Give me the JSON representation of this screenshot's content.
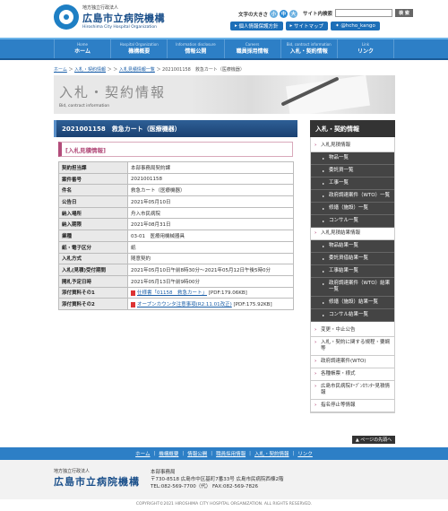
{
  "header": {
    "org_sub": "地方独立行政法人",
    "org_name": "広島市立病院機構",
    "org_en": "Hiroshima City Hospital Organization",
    "fontsize_label": "文字の大きさ",
    "fontsize_small": "小",
    "fontsize_medium": "中",
    "fontsize_large": "大",
    "search_label": "サイト内検索",
    "search_button": "検 索",
    "links": [
      "個人情報保護方針",
      "サイトマップ",
      "@hcho_kango"
    ]
  },
  "gnav": [
    {
      "en": "Home",
      "jp": "ホーム"
    },
    {
      "en": "Hospital Organization",
      "jp": "機構概要"
    },
    {
      "en": "Information disclosure",
      "jp": "情報公開"
    },
    {
      "en": "Careers",
      "jp": "職員採用情報"
    },
    {
      "en": "Bid, contract information",
      "jp": "入札・契約情報"
    },
    {
      "en": "Link",
      "jp": "リンク"
    }
  ],
  "breadcrumb": {
    "home": "ホーム",
    "level1": "入札・契約情報",
    "level2": "入札見積情報一覧",
    "current": "2021001158　救急カート（医療機器）"
  },
  "banner": {
    "title": "入札・契約情報",
    "subtitle": "Bid, contract information"
  },
  "main": {
    "title": "2021001158　救急カート（医療機器）",
    "category": "[入札見積情報]",
    "rows": [
      {
        "label": "契約担当課",
        "value": "本部事務局契約課"
      },
      {
        "label": "案件番号",
        "value": "2021001158"
      },
      {
        "label": "件名",
        "value": "救急カート（医療機器）"
      },
      {
        "label": "公告日",
        "value": "2021年05月10日"
      },
      {
        "label": "納入場所",
        "value": "舟入市民病院"
      },
      {
        "label": "納入期限",
        "value": "2021年08月31日"
      },
      {
        "label": "業種",
        "value": "03-01　医療用機械器具"
      },
      {
        "label": "紙・電子区分",
        "value": "紙"
      },
      {
        "label": "入札方式",
        "value": "随意契約"
      },
      {
        "label": "入札(見積)受付期間",
        "value": "2021年05月10日午前8時30分～2021年05月12日午後5時0分"
      },
      {
        "label": "開札予定日時",
        "value": "2021年05月13日午前9時00分"
      }
    ],
    "attach1_label": "添付資料その1",
    "attach1_link": "仕様書「01158　救急カート」",
    "attach1_size": "[PDF:179.06KB]",
    "attach2_label": "添付資料その2",
    "attach2_link": "オープンカウンタ注意事項(R2.11.01改正)",
    "attach2_size": "[PDF:175.92KB]"
  },
  "sidebar": {
    "head": "入札・契約情報",
    "group1": "入札見積情報",
    "group1_items": [
      "物品一覧",
      "委託資一覧",
      "工事一覧",
      "政府調達案件（WTO）一覧",
      "修繕（施設）一覧",
      "コンサル一覧"
    ],
    "group2": "入札見積結果情報",
    "group2_items": [
      "物品結果一覧",
      "委託資借結果一覧",
      "工事結果一覧",
      "政府調達案件（WTO）結果一覧",
      "修繕（施設）結果一覧",
      "コンサル結果一覧"
    ],
    "other_items": [
      "変更・中止公告",
      "入札・契約に関する規程・要綱等",
      "政府調達案件(WTO)",
      "各種帳票・様式",
      "広島市民病院ｵｰﾌﾟﾝｶｳﾝﾀｰ見積情報",
      "指名停止等情報"
    ]
  },
  "pagetop": "▲ ページの先頭へ",
  "footer_nav": [
    "ホーム",
    "機構概要",
    "情報公開",
    "職員採用情報",
    "入札・契約情報",
    "リンク"
  ],
  "footer": {
    "org_sub": "地方独立行政法人",
    "org_name": "広島市立病院機構",
    "addr_title": "本部事務局",
    "addr_line": "〒730-8518 広島市中区基町7番33号 広島市民病院西棟2階",
    "tel": "TEL:082-569-7700（代）  FAX:082-569-7826",
    "copyright": "COPYRIGHT©2021 HIROSHIMA CITY HOSPITAL ORGANIZATION. ALL RIGHTS RESERVED."
  }
}
